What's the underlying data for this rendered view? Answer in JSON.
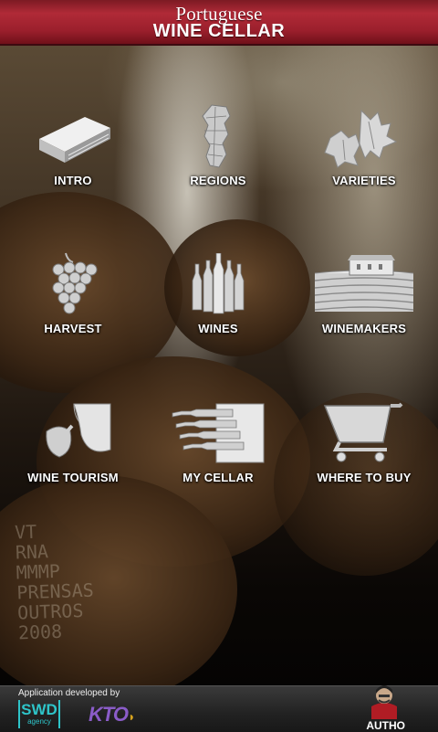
{
  "header": {
    "title_line1": "Portuguese",
    "title_line2": "WINE CELLAR"
  },
  "menu": {
    "items": [
      {
        "label": "INTRO",
        "icon": "book-icon"
      },
      {
        "label": "REGIONS",
        "icon": "portugal-map-icon"
      },
      {
        "label": "VARIETIES",
        "icon": "vine-leaves-icon"
      },
      {
        "label": "HARVEST",
        "icon": "grape-cluster-icon"
      },
      {
        "label": "WINES",
        "icon": "bottles-icon"
      },
      {
        "label": "WINEMAKERS",
        "icon": "vineyard-house-icon"
      },
      {
        "label": "WINE TOURISM",
        "icon": "pouring-glass-icon"
      },
      {
        "label": "MY CELLAR",
        "icon": "bottle-rack-icon"
      },
      {
        "label": "WHERE TO BUY",
        "icon": "shopping-cart-icon"
      }
    ]
  },
  "background": {
    "barrel_chalk_text": "VT\nRNA\nMMMP\nPRENSAS\nOUTROS\n2008"
  },
  "footer": {
    "developed_by": "Application developed by",
    "swd_logo_main": "SWD",
    "swd_logo_sub": "agency",
    "kto_logo": "KTO",
    "autho_label": "AUTHO"
  },
  "colors": {
    "header_red": "#a82634",
    "swd_cyan": "#2ec4c9",
    "kto_purple": "#8a5cc8",
    "icon_gray": "#d8d8d8"
  }
}
